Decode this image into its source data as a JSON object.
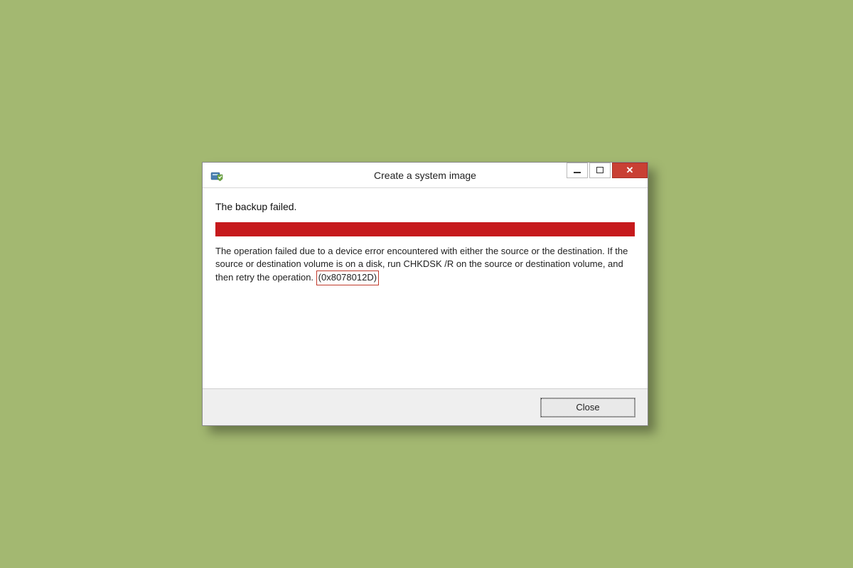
{
  "window": {
    "title": "Create a system image",
    "icon": "backup-shield-icon"
  },
  "content": {
    "status": "The backup failed.",
    "error_message": "The operation failed due to a device error encountered with either the source or the destination. If the source or destination volume is on a disk, run CHKDSK /R on the source or destination volume, and then retry the operation.",
    "error_code": "(0x8078012D)"
  },
  "footer": {
    "close_label": "Close"
  },
  "colors": {
    "background": "#a3b871",
    "error_bar": "#c6191c",
    "close_button": "#c94034"
  }
}
